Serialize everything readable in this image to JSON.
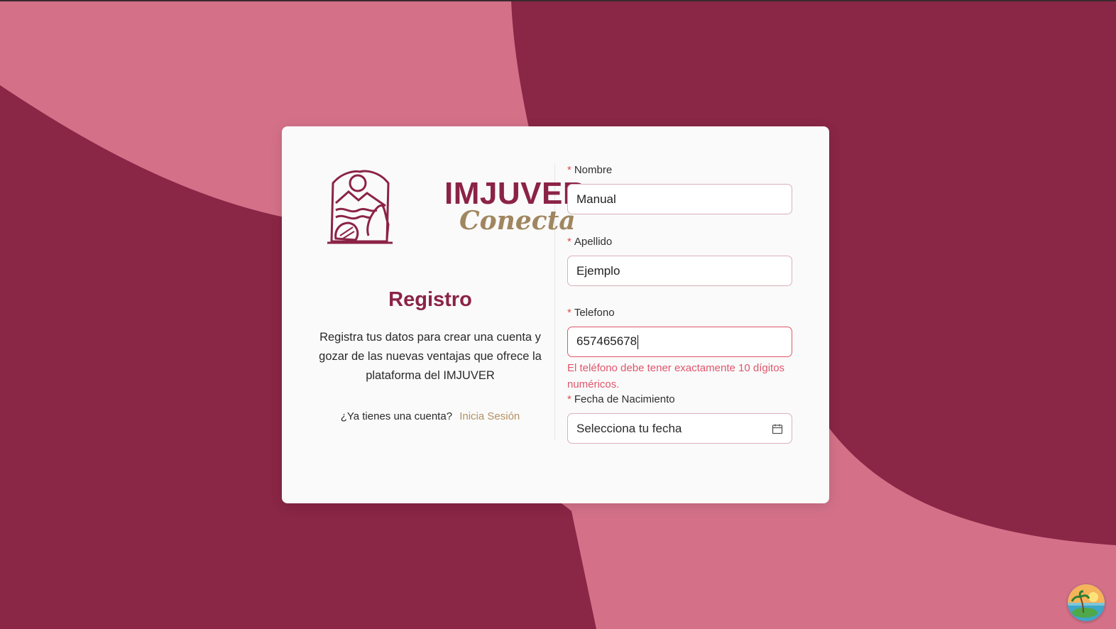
{
  "brand": {
    "name": "IMJUVER",
    "sub": "Conecta"
  },
  "intro": {
    "title": "Registro",
    "description": "Registra tus datos para crear una cuenta y gozar de las nuevas ventajas que ofrece la plataforma del IMJUVER",
    "login_prompt": "¿Ya tienes una cuenta?",
    "login_link": "Inicia Sesión"
  },
  "form": {
    "required_mark": "*",
    "nombre": {
      "label": "Nombre",
      "value": "Manual"
    },
    "apellido": {
      "label": "Apellido",
      "value": "Ejemplo"
    },
    "telefono": {
      "label": "Telefono",
      "value": "657465678",
      "error": "El teléfono debe tener exactamente 10 dígitos numéricos."
    },
    "fecha": {
      "label": "Fecha de Nacimiento",
      "placeholder": "Selecciona tu fecha",
      "icon": "calendar-icon"
    }
  },
  "colors": {
    "primary": "#8b2346",
    "accent": "#b49161",
    "background_light": "#d47189",
    "background_dark": "#8a2646",
    "error": "#e0566c"
  }
}
